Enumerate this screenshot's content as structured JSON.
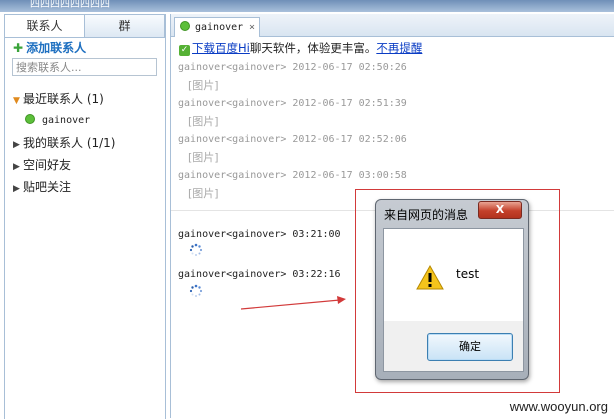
{
  "window": {
    "title": "四四四四四四四四"
  },
  "sidebar": {
    "tabs": [
      {
        "label": "联系人"
      },
      {
        "label": "群"
      }
    ],
    "add_contact_label": "添加联系人",
    "search_placeholder": "搜索联系人...",
    "groups": [
      {
        "label": "最近联系人 (1)",
        "expanded": true
      },
      {
        "label": "我的联系人 (1/1)",
        "expanded": false
      },
      {
        "label": "空间好友",
        "expanded": false
      },
      {
        "label": "贴吧关注",
        "expanded": false
      }
    ],
    "recent_contact": "gainover"
  },
  "chat": {
    "tab_label": "gainover",
    "tab_close": "×",
    "notice": {
      "link": "下载百度Hi",
      "text": "聊天软件，体验更丰富。",
      "dismiss": "不再提醒"
    },
    "history": [
      {
        "header": "gainover<gainover> 2012-06-17 02:50:26",
        "body": "[图片]"
      },
      {
        "header": "gainover<gainover> 2012-06-17 02:51:39",
        "body": "[图片]"
      },
      {
        "header": "gainover<gainover> 2012-06-17 02:52:06",
        "body": "[图片]"
      },
      {
        "header": "gainover<gainover> 2012-06-17 03:00:58",
        "body": "[图片]"
      }
    ],
    "recent": [
      {
        "header": "gainover<gainover> 03:21:00"
      },
      {
        "header": "gainover<gainover> 03:22:16"
      }
    ]
  },
  "dialog": {
    "title": "来自网页的消息",
    "close_label": "X",
    "message": "test",
    "ok_label": "确定"
  },
  "watermark": "www.wooyun.org",
  "colors": {
    "accent_red": "#d23a3a",
    "online": "#5cbf3a",
    "link": "#0a3cc4"
  }
}
